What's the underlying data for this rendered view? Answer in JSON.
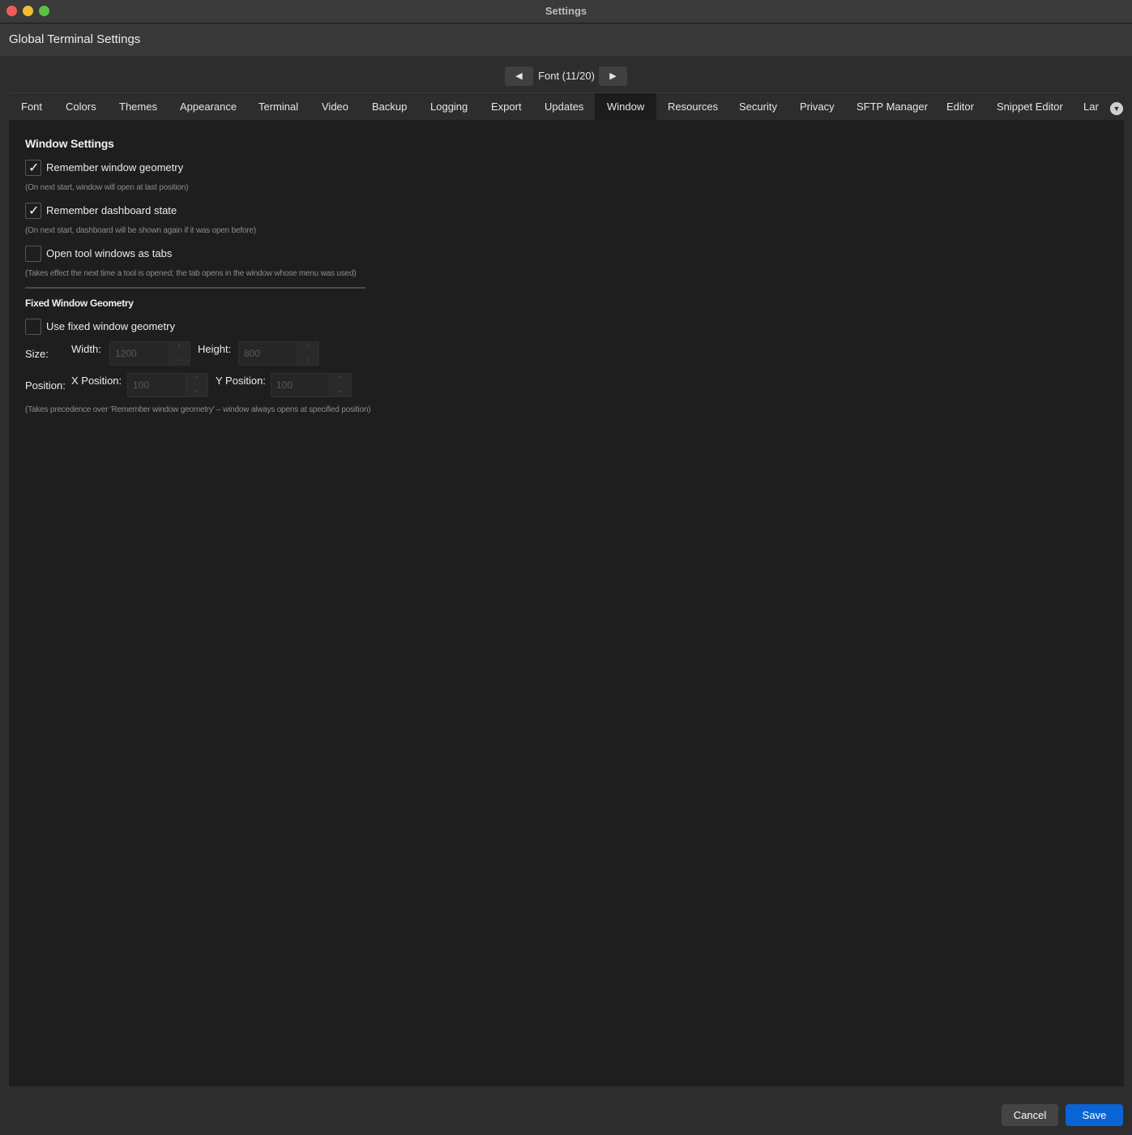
{
  "window": {
    "title": "Settings"
  },
  "header": {
    "title": "Global Terminal Settings"
  },
  "pager": {
    "prev_icon": "◀",
    "label": "Font (11/20)",
    "next_icon": "▶"
  },
  "tabs": [
    {
      "label": "Font"
    },
    {
      "label": "Colors"
    },
    {
      "label": "Themes"
    },
    {
      "label": "Appearance"
    },
    {
      "label": "Terminal"
    },
    {
      "label": "Video"
    },
    {
      "label": "Backup"
    },
    {
      "label": "Logging"
    },
    {
      "label": "Export"
    },
    {
      "label": "Updates"
    },
    {
      "label": "Window"
    },
    {
      "label": "Resources"
    },
    {
      "label": "Security"
    },
    {
      "label": "Privacy"
    },
    {
      "label": "SFTP Manager"
    },
    {
      "label": "Editor"
    },
    {
      "label": "Snippet Editor"
    },
    {
      "label": "Lang"
    }
  ],
  "active_tab": "Window",
  "tab_more_icon": "▼",
  "window_settings": {
    "title": "Window Settings",
    "remember_geometry": {
      "label": "Remember window geometry",
      "checked": true,
      "hint": "(On next start, window will open at last position)"
    },
    "remember_dashboard": {
      "label": "Remember dashboard state",
      "checked": true,
      "hint": "(On next start, dashboard will be shown again if it was open before)"
    },
    "tool_tabs": {
      "label": "Open tool windows as tabs",
      "checked": false,
      "hint": "(Takes effect the next time a tool is opened; the tab opens in the window whose menu was used)"
    }
  },
  "fixed_geometry": {
    "title": "Fixed Window Geometry",
    "use_fixed": {
      "label": "Use fixed window geometry",
      "checked": false
    },
    "size_label": "Size:",
    "width_label": "Width:",
    "width_value": "1200",
    "height_label": "Height:",
    "height_value": "800",
    "position_label": "Position:",
    "x_label": "X Position:",
    "x_value": "100",
    "y_label": "Y Position:",
    "y_value": "100",
    "hint": "(Takes precedence over 'Remember window geometry' – window always opens at specified position)"
  },
  "check_mark": "✓",
  "spin_up_icon": "⌃",
  "spin_down_icon": "⌄",
  "footer": {
    "cancel_label": "Cancel",
    "save_label": "Save"
  },
  "colors": {
    "accent": "#0a64d6",
    "background": "#1e1e1e",
    "chrome": "#2d2d2d"
  }
}
